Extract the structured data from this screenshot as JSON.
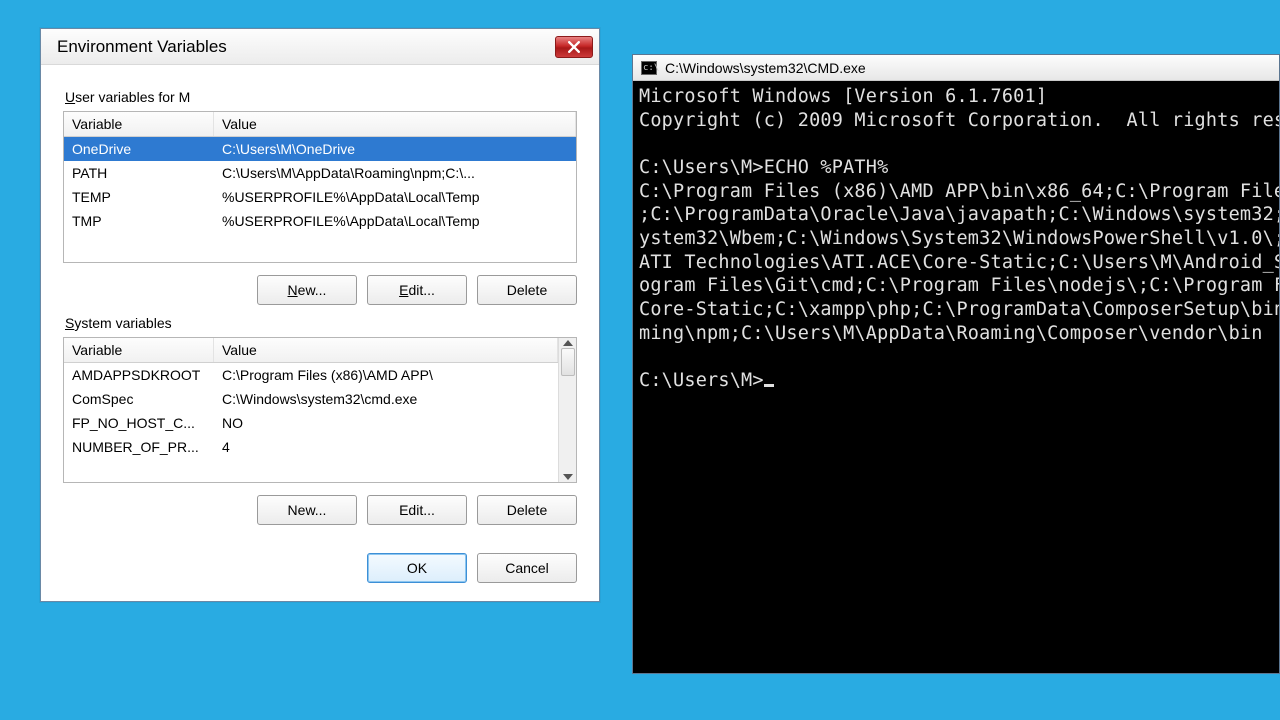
{
  "dialog": {
    "title": "Environment Variables",
    "user_section": {
      "label_prefix": "U",
      "label_rest": "ser variables for M",
      "columns": {
        "variable": "Variable",
        "value": "Value"
      },
      "rows": [
        {
          "variable": "OneDrive",
          "value": "C:\\Users\\M\\OneDrive",
          "selected": true
        },
        {
          "variable": "PATH",
          "value": "C:\\Users\\M\\AppData\\Roaming\\npm;C:\\..."
        },
        {
          "variable": "TEMP",
          "value": "%USERPROFILE%\\AppData\\Local\\Temp"
        },
        {
          "variable": "TMP",
          "value": "%USERPROFILE%\\AppData\\Local\\Temp"
        }
      ],
      "buttons": {
        "new_u": "N",
        "new_rest": "ew...",
        "edit_u": "E",
        "edit_rest": "dit...",
        "delete": "Delete"
      }
    },
    "system_section": {
      "label_prefix": "S",
      "label_rest": "ystem variables",
      "columns": {
        "variable": "Variable",
        "value": "Value"
      },
      "rows": [
        {
          "variable": "AMDAPPSDKROOT",
          "value": "C:\\Program Files (x86)\\AMD APP\\"
        },
        {
          "variable": "ComSpec",
          "value": "C:\\Windows\\system32\\cmd.exe"
        },
        {
          "variable": "FP_NO_HOST_C...",
          "value": "NO"
        },
        {
          "variable": "NUMBER_OF_PR...",
          "value": "4"
        }
      ],
      "buttons": {
        "new": "New...",
        "edit": "Edit...",
        "delete": "Delete"
      }
    },
    "actions": {
      "ok": "OK",
      "cancel": "Cancel"
    }
  },
  "cmd": {
    "title": "C:\\Windows\\system32\\CMD.exe",
    "lines": [
      "Microsoft Windows [Version 6.1.7601]",
      "Copyright (c) 2009 Microsoft Corporation.  All rights res",
      "",
      "C:\\Users\\M>ECHO %PATH%",
      "C:\\Program Files (x86)\\AMD APP\\bin\\x86_64;C:\\Program File",
      ";C:\\ProgramData\\Oracle\\Java\\javapath;C:\\Windows\\system32;",
      "ystem32\\Wbem;C:\\Windows\\System32\\WindowsPowerShell\\v1.0\\;",
      "ATI Technologies\\ATI.ACE\\Core-Static;C:\\Users\\M\\Android_S",
      "ogram Files\\Git\\cmd;C:\\Program Files\\nodejs\\;C:\\Program F",
      "Core-Static;C:\\xampp\\php;C:\\ProgramData\\ComposerSetup\\bin",
      "ming\\npm;C:\\Users\\M\\AppData\\Roaming\\Composer\\vendor\\bin",
      "",
      "C:\\Users\\M>"
    ]
  }
}
